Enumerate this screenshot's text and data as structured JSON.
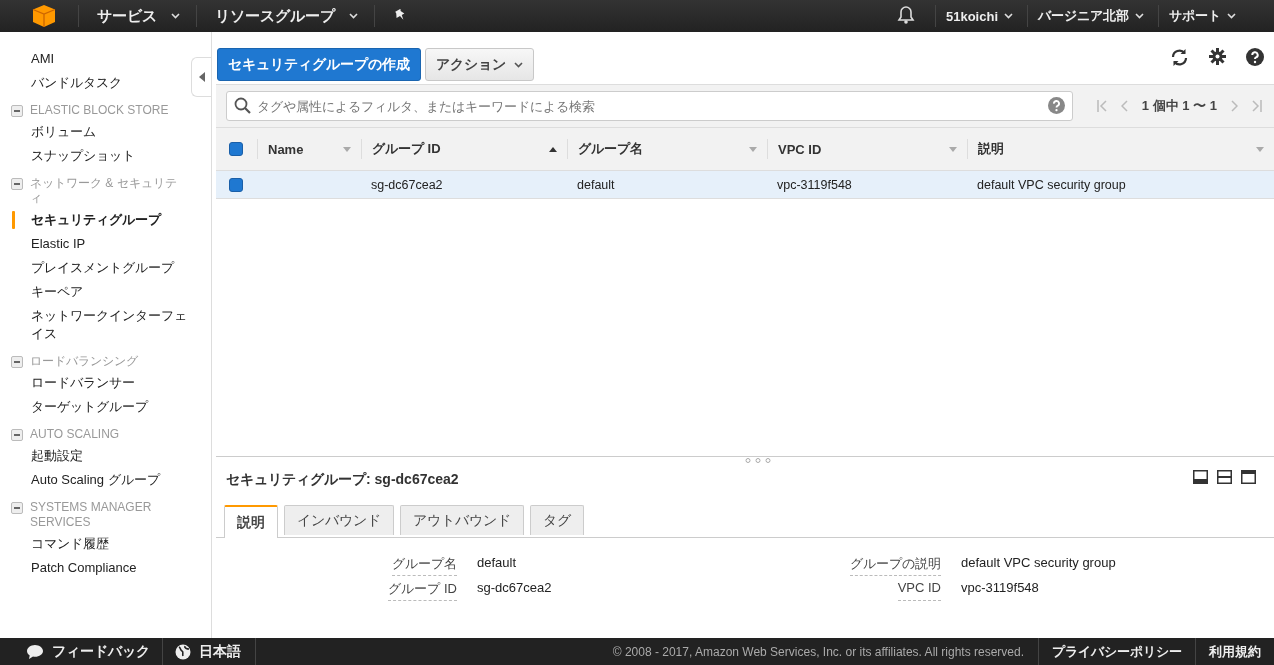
{
  "top_nav": {
    "menus": [
      {
        "label": "サービス"
      },
      {
        "label": "リソースグループ"
      }
    ],
    "right_menus": [
      {
        "label": "51koichi"
      },
      {
        "label": "バージニア北部"
      },
      {
        "label": "サポート"
      }
    ]
  },
  "sidebar": {
    "groups": [
      {
        "items": [
          {
            "label": "AMI",
            "selected": false
          },
          {
            "label": "バンドルタスク",
            "selected": false
          }
        ]
      },
      {
        "title": "ELASTIC BLOCK STORE",
        "expanded": true,
        "items": [
          {
            "label": "ボリューム",
            "selected": false
          },
          {
            "label": "スナップショット",
            "selected": false
          }
        ]
      },
      {
        "title": "ネットワーク & セキュリティ",
        "expanded": true,
        "items": [
          {
            "label": "セキュリティグループ",
            "selected": true
          },
          {
            "label": "Elastic IP",
            "selected": false
          },
          {
            "label": "プレイスメントグループ",
            "selected": false
          },
          {
            "label": "キーペア",
            "selected": false
          },
          {
            "label": "ネットワークインターフェイス",
            "selected": false
          }
        ]
      },
      {
        "title": "ロードバランシング",
        "expanded": true,
        "items": [
          {
            "label": "ロードバランサー",
            "selected": false
          },
          {
            "label": "ターゲットグループ",
            "selected": false
          }
        ]
      },
      {
        "title": "AUTO SCALING",
        "expanded": true,
        "items": [
          {
            "label": "起動設定",
            "selected": false
          },
          {
            "label": "Auto Scaling グループ",
            "selected": false
          }
        ]
      },
      {
        "title": "SYSTEMS MANAGER SERVICES",
        "expanded": true,
        "items": [
          {
            "label": "コマンド履歴",
            "selected": false
          },
          {
            "label": "Patch Compliance",
            "selected": false
          }
        ]
      }
    ]
  },
  "toolbar": {
    "create_button": "セキュリティグループの作成",
    "actions_button": "アクション"
  },
  "search": {
    "placeholder": "タグや属性によるフィルタ、またはキーワードによる検索"
  },
  "pagination": {
    "text": "1 個中 1 〜 1"
  },
  "table": {
    "all_checked": true,
    "columns": [
      {
        "label": "Name",
        "sorted": false
      },
      {
        "label": "グループ ID",
        "sorted": true
      },
      {
        "label": "グループ名",
        "sorted": false
      },
      {
        "label": "VPC ID",
        "sorted": false
      },
      {
        "label": "説明",
        "sorted": false
      }
    ],
    "rows": [
      {
        "selected": true,
        "checked": true,
        "cells": [
          "",
          "sg-dc67cea2",
          "default",
          "vpc-3119f548",
          "default VPC security group"
        ]
      }
    ]
  },
  "details": {
    "title": "セキュリティグループ: sg-dc67cea2",
    "tabs": [
      {
        "label": "説明",
        "selected": true
      },
      {
        "label": "インバウンド",
        "selected": false
      },
      {
        "label": "アウトバウンド",
        "selected": false
      },
      {
        "label": "タグ",
        "selected": false
      }
    ],
    "left_fields": [
      {
        "label": "グループ名",
        "value": "default"
      },
      {
        "label": "グループ ID",
        "value": "sg-dc67cea2"
      }
    ],
    "right_fields": [
      {
        "label": "グループの説明",
        "value": "default VPC security group"
      },
      {
        "label": "VPC ID",
        "value": "vpc-3119f548"
      }
    ]
  },
  "footer": {
    "feedback": "フィードバック",
    "language": "日本語",
    "copyright": "© 2008 - 2017, Amazon Web Services, Inc. or its affiliates. All rights reserved.",
    "links": [
      "プライバシーポリシー",
      "利用規約"
    ]
  }
}
